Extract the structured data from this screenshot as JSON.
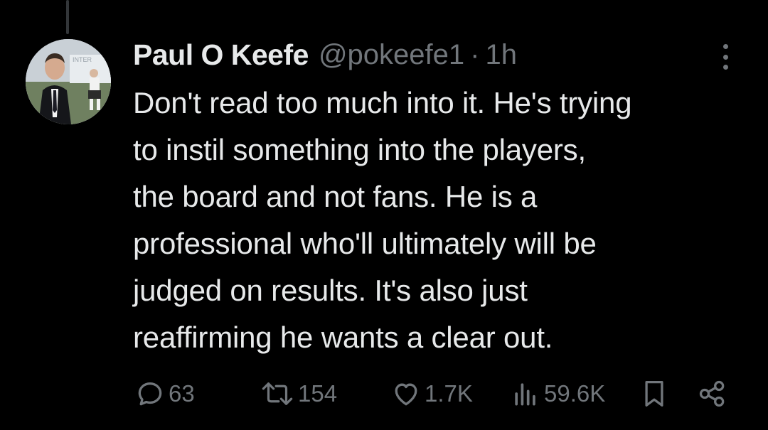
{
  "tweet": {
    "author": {
      "display_name": "Paul O Keefe",
      "handle": "@pokeefe1"
    },
    "separator": "·",
    "time": "1h",
    "text_lines": [
      "Don't read too much into it. He's trying",
      "to instil something into the players,",
      "the board and not fans. He is a",
      "professional who'll ultimately will be",
      "judged on results. It's also just",
      "reaffirming he wants a clear out."
    ],
    "metrics": {
      "replies": "63",
      "reposts": "154",
      "likes": "1.7K",
      "views": "59.6K"
    }
  },
  "avatar": {
    "sign_text": "INTER"
  },
  "icons": {
    "reply": "speech-bubble-icon",
    "repost": "repost-arrows-icon",
    "like": "heart-icon",
    "views": "bar-chart-icon",
    "bookmark": "bookmark-icon",
    "share": "share-nodes-icon",
    "more": "vertical-ellipsis-icon"
  },
  "colors": {
    "background": "#000000",
    "primary_text": "#e7e9ea",
    "secondary_text": "#71767b",
    "thread_line": "#333639"
  }
}
